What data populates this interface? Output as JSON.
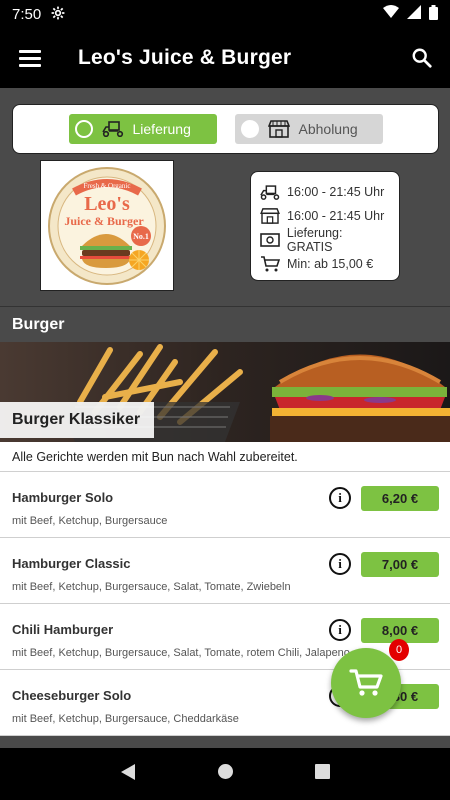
{
  "status_bar": {
    "time": "7:50"
  },
  "app_bar": {
    "title": "Leo's Juice & Burger"
  },
  "order_mode": {
    "delivery_label": "Lieferung",
    "pickup_label": "Abholung",
    "selected": "Lieferung"
  },
  "logo": {
    "line1": "Fresh & Organic",
    "line2": "Leo's",
    "line3": "Juice & Burger",
    "badge": "No.1"
  },
  "info": {
    "delivery_hours": "16:00 - 21:45 Uhr",
    "pickup_hours": "16:00 - 21:45 Uhr",
    "delivery_fee": "Lieferung: GRATIS",
    "minimum_order": "Min: ab 15,00 €"
  },
  "section": {
    "title": "Burger"
  },
  "category": {
    "title": "Burger Klassiker",
    "note": "Alle Gerichte werden mit Bun nach Wahl zubereitet."
  },
  "items": [
    {
      "name": "Hamburger Solo",
      "desc": "mit Beef, Ketchup, Burgersauce",
      "price": "6,20 €"
    },
    {
      "name": "Hamburger Classic",
      "desc": "mit Beef, Ketchup, Burgersauce, Salat, Tomate, Zwiebeln",
      "price": "7,00 €"
    },
    {
      "name": "Chili Hamburger",
      "desc": "mit Beef, Ketchup, Burgersauce, Salat, Tomate, rotem Chili, Jalapeno",
      "price": "8,00 €"
    },
    {
      "name": "Cheeseburger Solo",
      "desc": "mit Beef, Ketchup, Burgersauce, Cheddarkäse",
      "price": "6,80 €"
    }
  ],
  "cart": {
    "count": "0"
  },
  "colors": {
    "accent": "#7dc242",
    "badge": "#e30000"
  }
}
